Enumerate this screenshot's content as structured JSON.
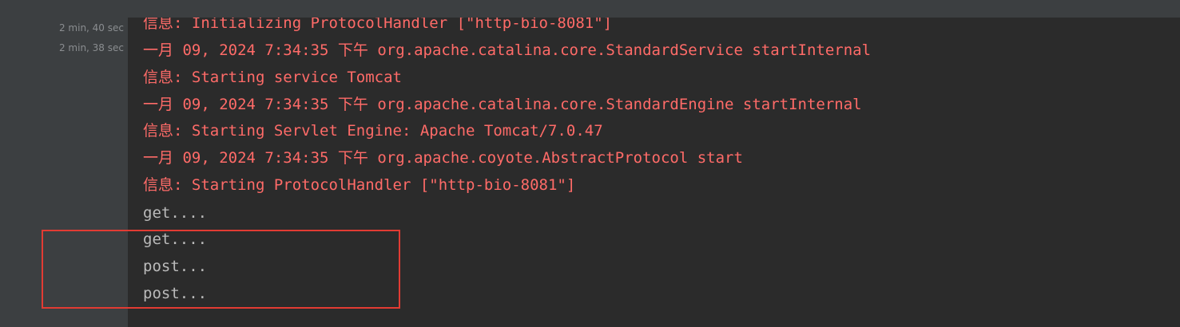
{
  "timestamps": [
    "2 min, 40 sec",
    "2 min, 38 sec"
  ],
  "console_lines": [
    {
      "text": "信息: Initializing ProtocolHandler [\"http-bio-8081\"]",
      "style": "error"
    },
    {
      "text": "一月 09, 2024 7:34:35 下午 org.apache.catalina.core.StandardService startInternal",
      "style": "error"
    },
    {
      "text": "信息: Starting service Tomcat",
      "style": "error"
    },
    {
      "text": "一月 09, 2024 7:34:35 下午 org.apache.catalina.core.StandardEngine startInternal",
      "style": "error"
    },
    {
      "text": "信息: Starting Servlet Engine: Apache Tomcat/7.0.47",
      "style": "error"
    },
    {
      "text": "一月 09, 2024 7:34:35 下午 org.apache.coyote.AbstractProtocol start",
      "style": "error"
    },
    {
      "text": "信息: Starting ProtocolHandler [\"http-bio-8081\"]",
      "style": "error"
    },
    {
      "text": "get....",
      "style": "normal"
    },
    {
      "text": "get....",
      "style": "normal"
    },
    {
      "text": "post...",
      "style": "normal"
    },
    {
      "text": "post...",
      "style": "normal"
    }
  ],
  "colors": {
    "error_text": "#ff6b68",
    "normal_text": "#bbbbbb",
    "background": "#2b2b2b",
    "gutter": "#3c3f41",
    "highlight_border": "#e23b33"
  }
}
